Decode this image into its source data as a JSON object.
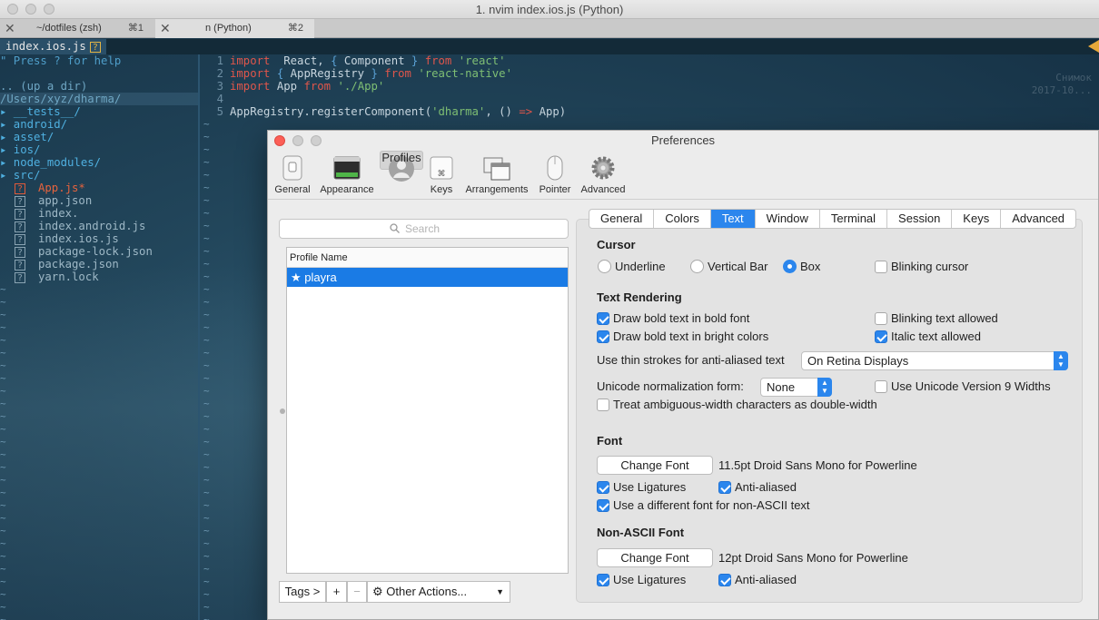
{
  "window": {
    "title": "1. nvim index.ios.js (Python)",
    "tabs": [
      {
        "label": "~/dotfiles (zsh)",
        "shortcut": "⌘1"
      },
      {
        "label": "n (Python)",
        "shortcut": "⌘2"
      }
    ]
  },
  "terminal": {
    "filename": "index.ios.js",
    "badge": "?",
    "tree_lines": [
      "\" Press ? for help",
      "",
      ".. (up a dir)",
      "/Users/xyz/dharma/",
      "▸ __tests__/",
      "▸ android/",
      "▸ asset/",
      "▸ ios/",
      "▸ node_modules/",
      "▸ src/"
    ],
    "files": [
      {
        "icon": "?",
        "name": "App.js*"
      },
      {
        "icon": "?",
        "name": "app.json"
      },
      {
        "icon": "?",
        "name": "index."
      },
      {
        "icon": "?",
        "name": "index.android.js"
      },
      {
        "icon": "?",
        "name": "index.ios.js"
      },
      {
        "icon": "?",
        "name": "package-lock.json"
      },
      {
        "icon": "?",
        "name": "package.json"
      },
      {
        "icon": "?",
        "name": "yarn.lock"
      }
    ],
    "code": [
      {
        "n": "1",
        "parts": [
          [
            "kw",
            "import"
          ],
          [
            "",
            "  React, "
          ],
          [
            "br",
            "{"
          ],
          [
            "",
            " Component "
          ],
          [
            "br",
            "}"
          ],
          [
            "",
            " "
          ],
          [
            "kw",
            "from"
          ],
          [
            "",
            " "
          ],
          [
            "str",
            "'react'"
          ]
        ]
      },
      {
        "n": "2",
        "parts": [
          [
            "kw",
            "import"
          ],
          [
            "",
            "",
            " "
          ],
          [
            "br",
            "{"
          ],
          [
            "",
            " AppRegistry "
          ],
          [
            "br",
            "}"
          ],
          [
            "",
            " "
          ],
          [
            "kw",
            "from"
          ],
          [
            "",
            " "
          ],
          [
            "str",
            "'react-native'"
          ]
        ]
      },
      {
        "n": "3",
        "parts": [
          [
            "kw",
            "import"
          ],
          [
            "",
            " App "
          ],
          [
            "kw",
            "from"
          ],
          [
            "",
            " "
          ],
          [
            "str",
            "'./App'"
          ]
        ]
      },
      {
        "n": "4",
        "parts": []
      },
      {
        "n": "5",
        "parts": [
          [
            "",
            "AppRegistry.registerComponent("
          ],
          [
            "str",
            "'dharma'"
          ],
          [
            "",
            ", () "
          ],
          [
            "kw",
            "=>"
          ],
          [
            "",
            " App)"
          ]
        ]
      }
    ],
    "watermark": [
      "Снимок",
      "2017-10..."
    ]
  },
  "prefs": {
    "title": "Preferences",
    "toolbar": [
      "General",
      "Appearance",
      "Profiles",
      "Keys",
      "Arrangements",
      "Pointer",
      "Advanced"
    ],
    "search_placeholder": "Search",
    "profile_header": "Profile Name",
    "profile": "★ playra",
    "tags_label": "Tags >",
    "add": "+",
    "remove": "−",
    "other_actions": "Other Actions...",
    "tabs": [
      "General",
      "Colors",
      "Text",
      "Window",
      "Terminal",
      "Session",
      "Keys",
      "Advanced"
    ],
    "cursor": {
      "header": "Cursor",
      "underline": "Underline",
      "vertical": "Vertical Bar",
      "box": "Box",
      "blinking": "Blinking cursor"
    },
    "rendering": {
      "header": "Text Rendering",
      "bold_font": "Draw bold text in bold font",
      "bright": "Draw bold text in bright colors",
      "blink_allowed": "Blinking text allowed",
      "italic": "Italic text allowed",
      "thin_label": "Use thin strokes for anti-aliased text",
      "thin_value": "On Retina Displays",
      "unicode_label": "Unicode normalization form:",
      "unicode_value": "None",
      "unicode9": "Use Unicode Version 9 Widths",
      "ambiguous": "Treat ambiguous-width characters as double-width"
    },
    "font": {
      "header": "Font",
      "change": "Change Font",
      "desc": "11.5pt Droid Sans Mono for Powerline",
      "ligatures": "Use Ligatures",
      "antialiased": "Anti-aliased",
      "nonascii": "Use a different font for non-ASCII text"
    },
    "nonascii_font": {
      "header": "Non-ASCII Font",
      "change": "Change Font",
      "desc": "12pt Droid Sans Mono for Powerline",
      "ligatures": "Use Ligatures",
      "antialiased": "Anti-aliased"
    },
    "colors": {
      "accent": "#2b86ed",
      "close": "#fc5f57",
      "minimize": "#c8c8c8"
    }
  }
}
